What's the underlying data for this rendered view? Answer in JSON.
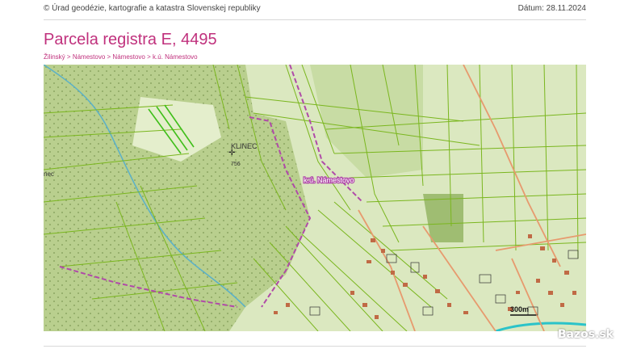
{
  "header": {
    "copyright": "© Úrad geodézie, kartografie a katastra Slovenskej republiky",
    "date": "Dátum: 28.11.2024"
  },
  "title": "Parcela registra E, 4495",
  "breadcrumb": [
    "Žilinský",
    "Námestovo",
    "Námestovo",
    "k.ú. Námestovo"
  ],
  "breadcrumb_separator": ">",
  "map": {
    "labels": {
      "hill_name": "KLINEC",
      "hill_elevation": "756",
      "cadastral_area": "k.ú. Námestovo",
      "partial_left": "nec",
      "scale": "300m"
    },
    "colors": {
      "forest": "#b9cf8e",
      "meadow": "#d9e6bd",
      "parcel_lines": "#7ab61e",
      "boundary": "#b04aa8",
      "road": "#e79a6e",
      "building": "#c06a45",
      "water": "#5ab0c8"
    }
  },
  "watermark": "Bazos.sk"
}
